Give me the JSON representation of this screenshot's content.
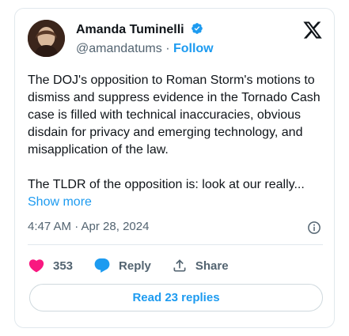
{
  "author": {
    "name": "Amanda Tuminelli",
    "handle": "@amandatums",
    "separator": "·",
    "follow_label": "Follow"
  },
  "tweet": {
    "paragraph1": "The DOJ's opposition to Roman Storm's motions to dismiss and suppress evidence in the Tornado Cash case is filled with technical inaccuracies, obvious disdain for privacy and emerging technology, and misapplication of the law.",
    "paragraph2": "The TLDR of the opposition is: look at our really...",
    "show_more": "Show more",
    "timestamp": "4:47 AM · Apr 28, 2024"
  },
  "actions": {
    "like_count": "353",
    "reply_label": "Reply",
    "share_label": "Share"
  },
  "footer": {
    "read_replies_label": "Read 23 replies"
  },
  "colors": {
    "accent": "#1d9bf0",
    "like": "#f91880",
    "muted": "#536471"
  },
  "icons": [
    "verified-badge-icon",
    "x-logo-icon",
    "info-icon",
    "heart-icon",
    "reply-bubble-icon",
    "share-icon"
  ]
}
